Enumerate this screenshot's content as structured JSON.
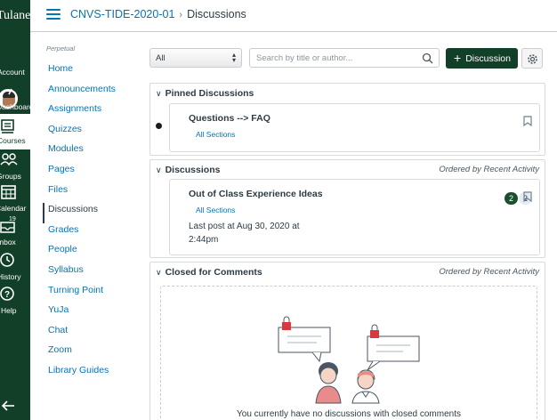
{
  "global_nav": {
    "brand": "Tulane",
    "items": [
      {
        "label": "Account",
        "icon": "account-avatar"
      },
      {
        "label": "Dashboard",
        "icon": "dashboard-icon"
      },
      {
        "label": "Courses",
        "icon": "courses-icon"
      },
      {
        "label": "Groups",
        "icon": "groups-icon"
      },
      {
        "label": "Calendar",
        "icon": "calendar-icon"
      },
      {
        "label": "Inbox",
        "icon": "inbox-icon",
        "badge": "19"
      },
      {
        "label": "History",
        "icon": "history-icon"
      },
      {
        "label": "Help",
        "icon": "help-icon"
      }
    ],
    "active": "Courses",
    "colors": {
      "nav_bg": "#123f28",
      "link": "#0374b5"
    }
  },
  "header": {
    "course": "CNVS-TIDE-2020-01",
    "separator": "›",
    "current": "Discussions"
  },
  "course_nav": {
    "term": "Perpetual",
    "items": [
      "Home",
      "Announcements",
      "Assignments",
      "Quizzes",
      "Modules",
      "Pages",
      "Files",
      "Discussions",
      "Grades",
      "People",
      "Syllabus",
      "Turning Point",
      "YuJa",
      "Chat",
      "Zoom",
      "Library Guides"
    ],
    "active": "Discussions"
  },
  "toolbar": {
    "filter_value": "All",
    "search_placeholder": "Search by title or author...",
    "add_label": "Discussion"
  },
  "pinned": {
    "title": "Pinned Discussions",
    "discussion": {
      "title": "Questions --> FAQ",
      "sections": "All Sections"
    }
  },
  "discussions": {
    "title": "Discussions",
    "ordered_by": "Ordered by Recent Activity",
    "discussion": {
      "title": "Out of Class Experience Ideas",
      "sections": "All Sections",
      "last_post": "Last post at Aug 30, 2020 at 2:44pm",
      "unread_count": "2",
      "total_count": "2"
    }
  },
  "closed": {
    "title": "Closed for Comments",
    "ordered_by": "Ordered by Recent Activity",
    "empty_text": "You currently have no discussions with closed comments"
  }
}
